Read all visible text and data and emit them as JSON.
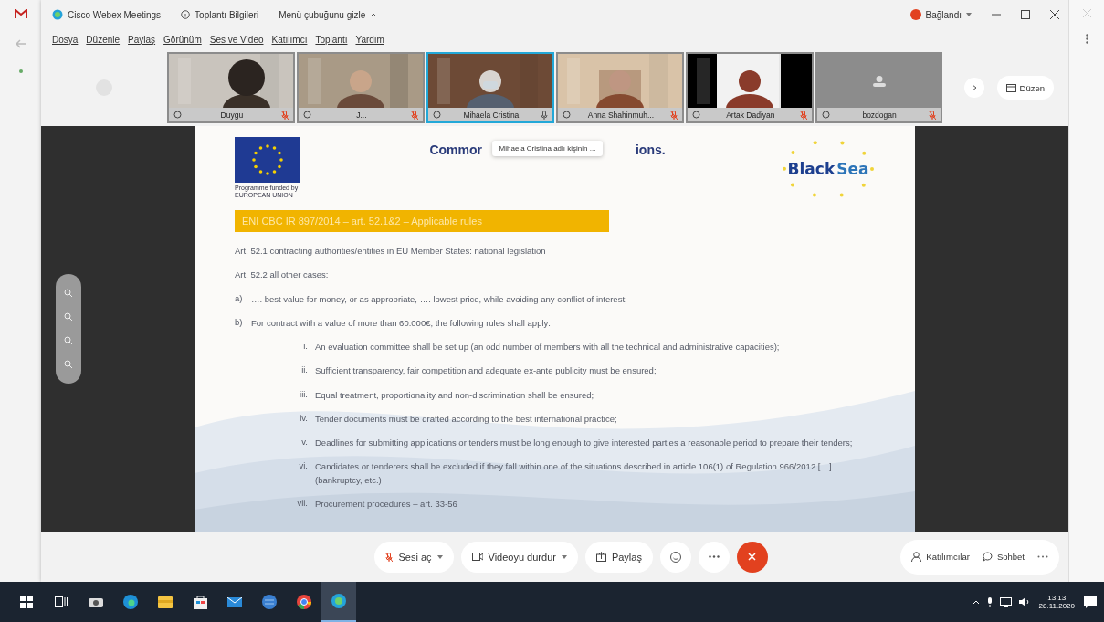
{
  "window": {
    "app_name": "Cisco Webex Meetings",
    "info_label": "Toplantı Bilgileri",
    "menu_toggle": "Menü çubuğunu gizle",
    "status": "Bağlandı"
  },
  "menu": [
    "Dosya",
    "Düzenle",
    "Paylaş",
    "Görünüm",
    "Ses ve Video",
    "Katılımcı",
    "Toplantı",
    "Yardım"
  ],
  "participants": [
    {
      "name": "Duygu",
      "kind": "video",
      "selected": false,
      "muted": true
    },
    {
      "name": "J...",
      "kind": "video",
      "selected": false,
      "muted": true
    },
    {
      "name": "Mihaela Cristina",
      "kind": "video",
      "selected": true,
      "muted": false
    },
    {
      "name": "Anna Shahinmuh...",
      "kind": "video",
      "selected": false,
      "muted": true
    },
    {
      "name": "Artak Dadiyan",
      "kind": "video",
      "selected": false,
      "muted": true
    },
    {
      "name": "bozdogan",
      "kind": "avatar",
      "selected": false,
      "muted": true
    }
  ],
  "layout_button": "Düzen",
  "slide": {
    "title_start": "Commor",
    "title_end": "ions.",
    "tooltip": "Mihaela Cristina adlı kişinin ...",
    "eu_caption": "Programme funded by EUROPEAN UNION",
    "logo_word_1": "Black",
    "logo_word_2": "Sea",
    "banner": "ENI CBC IR 897/2014 – art. 52.1&2 – Applicable rules",
    "lines": [
      {
        "text": "Art. 52.1 contracting authorities/entities in EU Member States: national legislation"
      },
      {
        "text": "Art. 52.2 all other cases:"
      },
      {
        "marker": "a)",
        "text": "…. best value for money, or as appropriate, …. lowest price, while avoiding any conflict of interest;"
      },
      {
        "marker": "b)",
        "text": "For contract with a value of more than 60.000€, the following rules shall apply:",
        "children": [
          {
            "marker": "i.",
            "text": "An evaluation committee shall be set up (an odd number of members with all the technical and administrative capacities);"
          },
          {
            "marker": "ii.",
            "text": "Sufficient transparency, fair competition and adequate ex-ante publicity must be ensured;"
          },
          {
            "marker": "iii.",
            "text": "Equal treatment, proportionality and non-discrimination shall be ensured;"
          },
          {
            "marker": "iv.",
            "text": "Tender documents must be drafted according to the best international practice;"
          },
          {
            "marker": "v.",
            "text": "Deadlines for submitting applications or tenders must be long enough to give interested parties a reasonable period to prepare their tenders;"
          },
          {
            "marker": "vi.",
            "text": "Candidates or tenderers shall be excluded if they fall within one of the situations described in article 106(1) of Regulation 966/2012 […] (bankruptcy, etc.)"
          },
          {
            "marker": "vii.",
            "text": "Procurement procedures – art. 33-56"
          }
        ]
      }
    ]
  },
  "controls": {
    "audio": {
      "label": "Sesi aç",
      "muted": true
    },
    "video": "Videoyu durdur",
    "share": "Paylaş",
    "participants": "Katılımcılar",
    "chat": "Sohbet"
  },
  "clock": {
    "time": "13:13",
    "date": "28.11.2020"
  }
}
